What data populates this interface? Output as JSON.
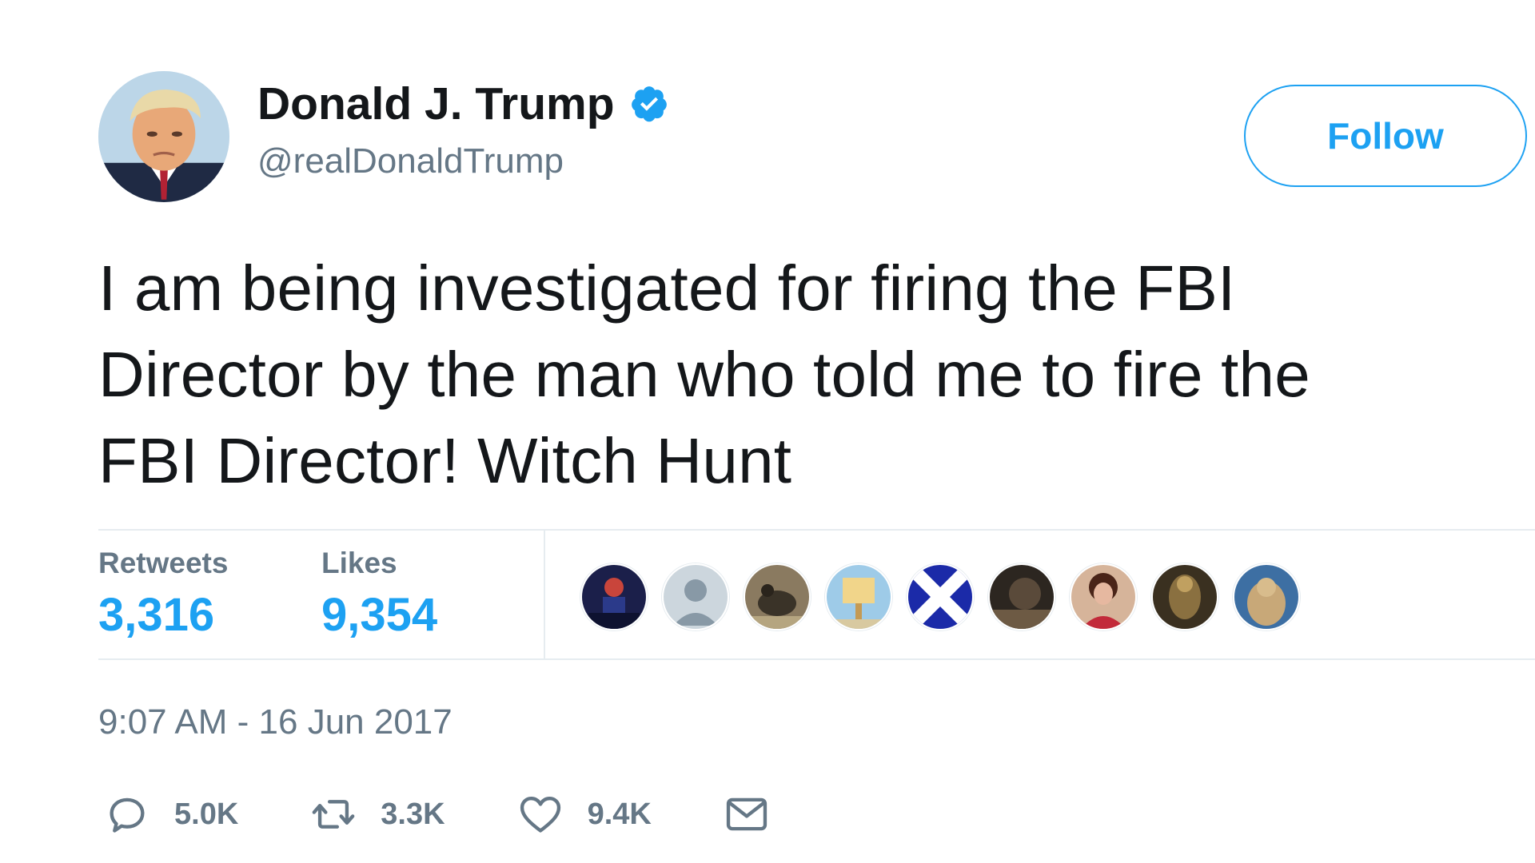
{
  "user": {
    "display_name": "Donald J. Trump",
    "handle": "@realDonaldTrump",
    "verified": true
  },
  "follow_button": {
    "label": "Follow"
  },
  "tweet": {
    "text": "I am being investigated for firing the FBI\nDirector by the man who told me to fire the\nFBI Director! Witch Hunt",
    "timestamp": "9:07 AM - 16 Jun 2017"
  },
  "stats": {
    "retweets_label": "Retweets",
    "retweets_count": "3,316",
    "likes_label": "Likes",
    "likes_count": "9,354"
  },
  "likers": [
    {
      "icon": "liker-avatar-1"
    },
    {
      "icon": "liker-avatar-default"
    },
    {
      "icon": "liker-avatar-3"
    },
    {
      "icon": "liker-avatar-4"
    },
    {
      "icon": "liker-avatar-saltire"
    },
    {
      "icon": "liker-avatar-6"
    },
    {
      "icon": "liker-avatar-7"
    },
    {
      "icon": "liker-avatar-8"
    },
    {
      "icon": "liker-avatar-9"
    }
  ],
  "actions": {
    "reply": {
      "icon": "reply-icon",
      "count": "5.0K"
    },
    "retweet": {
      "icon": "retweet-icon",
      "count": "3.3K"
    },
    "like": {
      "icon": "heart-icon",
      "count": "9.4K"
    },
    "message": {
      "icon": "envelope-icon"
    }
  },
  "colors": {
    "accent": "#1da1f2",
    "text": "#14171a",
    "secondary_text": "#657786",
    "divider": "#e6ecf0"
  }
}
